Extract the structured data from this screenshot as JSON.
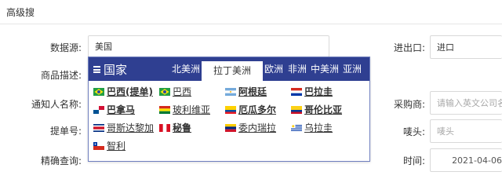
{
  "page": {
    "title": "高级搜"
  },
  "form": {
    "data_source": {
      "label": "数据源:",
      "value": "美国"
    },
    "product_desc": {
      "label": "商品描述:"
    },
    "notify_name": {
      "label": "通知人名称:"
    },
    "bill_no": {
      "label": "提单号:"
    },
    "exact_query": {
      "label": "精确查询:"
    },
    "import_export": {
      "label": "进出口:",
      "value": "进口"
    },
    "buyer": {
      "label": "采购商:",
      "placeholder": "请输入英文公司名"
    },
    "mark": {
      "label": "唛头:",
      "placeholder": "唛头"
    },
    "time": {
      "label": "时间:",
      "value": "2021-04-06"
    }
  },
  "popup": {
    "title": "国家",
    "tabs": [
      "北美洲",
      "拉丁美洲",
      "欧洲",
      "非洲",
      "中美洲",
      "亚洲"
    ],
    "active_tab": "拉丁美洲",
    "countries": [
      {
        "name": "巴西(提单)",
        "flag": "brazil-flag",
        "bold": true
      },
      {
        "name": "巴西",
        "flag": "brazil-flag",
        "bold": false
      },
      {
        "name": "阿根廷",
        "flag": "argentina-flag",
        "bold": true
      },
      {
        "name": "巴拉圭",
        "flag": "paraguay-flag",
        "bold": true
      },
      {
        "name": "巴拿马",
        "flag": "panama-flag",
        "bold": true
      },
      {
        "name": "玻利维亚",
        "flag": "bolivia-flag",
        "bold": false
      },
      {
        "name": "厄瓜多尔",
        "flag": "ecuador-flag",
        "bold": true
      },
      {
        "name": "哥伦比亚",
        "flag": "colombia-flag",
        "bold": true
      },
      {
        "name": "哥斯达黎加",
        "flag": "costa-rica-flag",
        "bold": false
      },
      {
        "name": "秘鲁",
        "flag": "peru-flag",
        "bold": true
      },
      {
        "name": "委内瑞拉",
        "flag": "venezuela-flag",
        "bold": false
      },
      {
        "name": "乌拉圭",
        "flag": "uruguay-flag",
        "bold": false
      },
      {
        "name": "智利",
        "flag": "chile-flag",
        "bold": false
      }
    ]
  },
  "colors": {
    "popup_header": "#2f3f91",
    "border": "#d9d9d9"
  }
}
